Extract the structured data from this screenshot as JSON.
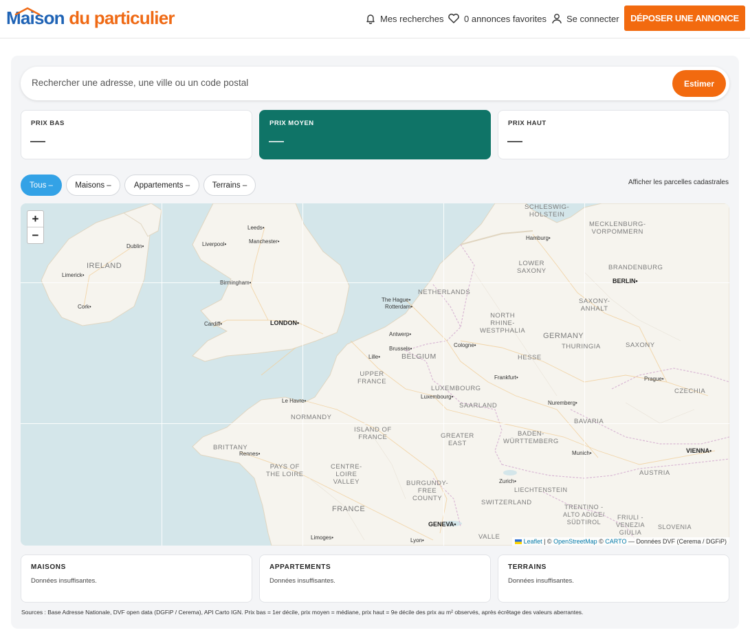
{
  "header": {
    "logo_part1": "Maison",
    "logo_part2": "du particulier",
    "nav_searches": "Mes recherches",
    "nav_favorites": "0 annonces favorites",
    "nav_login": "Se connecter",
    "cta_label": "DÉPOSER UNE ANNONCE"
  },
  "search": {
    "placeholder": "Rechercher une adresse, une ville ou un code postal",
    "button_label": "Estimer"
  },
  "price_cards": [
    {
      "label": "PRIX BAS",
      "value": "—"
    },
    {
      "label": "PRIX MOYEN",
      "value": "—"
    },
    {
      "label": "PRIX HAUT",
      "value": "—"
    }
  ],
  "filters": [
    {
      "label": "Tous –",
      "active": true
    },
    {
      "label": "Maisons –",
      "active": false
    },
    {
      "label": "Appartements –",
      "active": false
    },
    {
      "label": "Terrains –",
      "active": false
    }
  ],
  "cadastre_link": "Afficher les parcelles cadastrales",
  "map": {
    "zoom_in": "+",
    "zoom_out": "−",
    "attribution": {
      "leaflet": "Leaflet",
      "sep1": " | © ",
      "osm": "OpenStreetMap",
      "sep2": " © ",
      "carto": "CARTO",
      "rest": " — Données DVF (Cerema / DGFiP)"
    },
    "cities": [
      "Leeds",
      "Dublin",
      "Liverpool",
      "Manchester",
      "Limerick",
      "Birmingham",
      "Cork",
      "Cardiff",
      "LONDON",
      "The Hague",
      "Rotterdam",
      "Antwerp",
      "Brussels",
      "Lille",
      "Cologne",
      "Hamburg",
      "BERLIN",
      "Frankfurt",
      "Luxembourg",
      "Le Havre",
      "Rennes",
      "Prague",
      "Nuremberg",
      "Munich",
      "VIENNA",
      "Zurich",
      "GENEVA",
      "Limoges",
      "Lyon",
      "VALLE"
    ],
    "regions": [
      "SCHLESWIG-\nHOLSTEIN",
      "MECKLENBURG-\nVORPOMMERN",
      "IRELAND",
      "LOWER\nSAXONY",
      "BRANDENBURG",
      "NETHERLANDS",
      "SAXONY-\nANHALT",
      "NORTH\nRHINE-\nWESTPHALIA",
      "GERMANY",
      "BELGIUM",
      "THURINGIA",
      "SAXONY",
      "HESSE",
      "UPPER\nFRANCE",
      "LUXEMBOURG",
      "SAARLAND",
      "CZECHIA",
      "NORMANDY",
      "ISLAND OF\nFRANCE",
      "GREATER\nEAST",
      "BADEN-\nWÜRTTEMBERG",
      "BAVARIA",
      "BRITTANY",
      "PAYS OF\nTHE LOIRE",
      "CENTRE-\nLOIRE\nVALLEY",
      "AUSTRIA",
      "BURGUNDY-\nFREE\nCOUNTY",
      "LIECHTENSTEIN",
      "SWITZERLAND",
      "FRANCE",
      "TRENTINO -\nALTO ADIGE/\nSÜDTIROL",
      "FRIULI -\nVENEZIA\nGIULIA",
      "SLOVENIA"
    ]
  },
  "type_cards": [
    {
      "label": "MAISONS",
      "text": "Données insuffisantes."
    },
    {
      "label": "APPARTEMENTS",
      "text": "Données insuffisantes."
    },
    {
      "label": "TERRAINS",
      "text": "Données insuffisantes."
    }
  ],
  "sources": "Sources : Base Adresse Nationale, DVF open data (DGFiP / Cerema), API Carto IGN. Prix bas = 1er décile, prix moyen = médiane, prix haut = 9e décile des prix au m² observés, après écrêtage des valeurs aberrantes.",
  "colors": {
    "brand_blue": "#1f63b5",
    "brand_orange": "#f26a0f",
    "active_card": "#0f7467",
    "active_pill": "#33a2e6",
    "map_sea": "#d4e6ea",
    "map_land": "#f6f4ee"
  }
}
